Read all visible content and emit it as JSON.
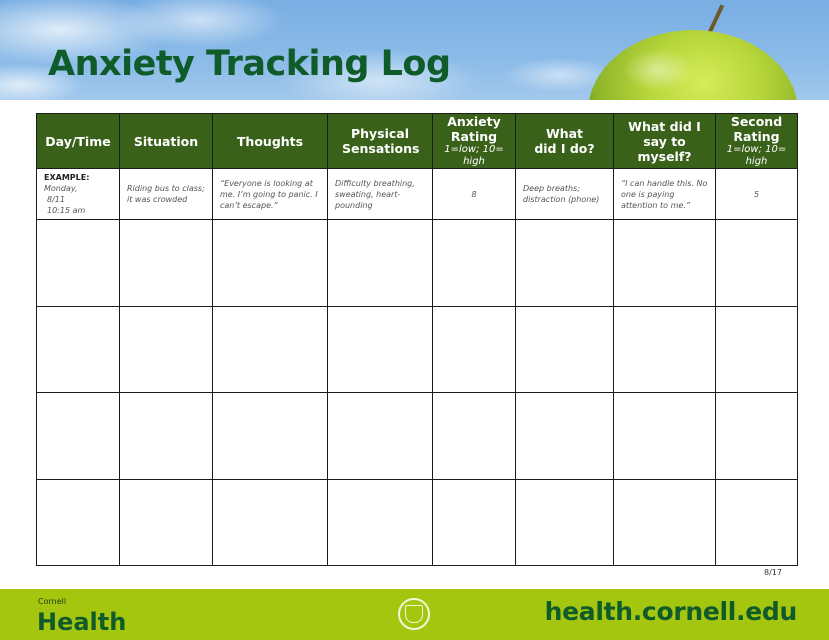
{
  "header": {
    "title": "Anxiety Tracking Log",
    "banner_image": "sky-with-green-apple"
  },
  "table": {
    "columns": [
      {
        "label": "Day/Time",
        "sub": ""
      },
      {
        "label": "Situation",
        "sub": ""
      },
      {
        "label": "Thoughts",
        "sub": ""
      },
      {
        "label": "Physical Sensations",
        "sub": ""
      },
      {
        "label": "Anxiety Rating",
        "sub": "1=low; 10= high"
      },
      {
        "label": "What did I do?",
        "sub": ""
      },
      {
        "label": "What did I say to myself?",
        "sub": ""
      },
      {
        "label": "Second Rating",
        "sub": "1=low; 10= high"
      }
    ],
    "example": {
      "label": "EXAMPLE:",
      "day": "Monday,",
      "date": "8/11",
      "time": "10:15 am",
      "situation": "Riding bus to class; it was crowded",
      "thoughts": "“Everyone is looking at me. I’m going to panic. I can’t escape.”",
      "sensations": "Difficulty breathing, sweating, heart-pounding",
      "anxiety_rating": "8",
      "action": "Deep breaths; distraction (phone)",
      "self_talk": "“I can handle this. No one is paying attention to me.”",
      "second_rating": "5"
    },
    "blank_rows": 4
  },
  "page_number": "8/17",
  "footer": {
    "brand_small": "Cornell",
    "brand_big": "Health",
    "seal": "cornell-university-seal",
    "url": "health.cornell.edu"
  }
}
